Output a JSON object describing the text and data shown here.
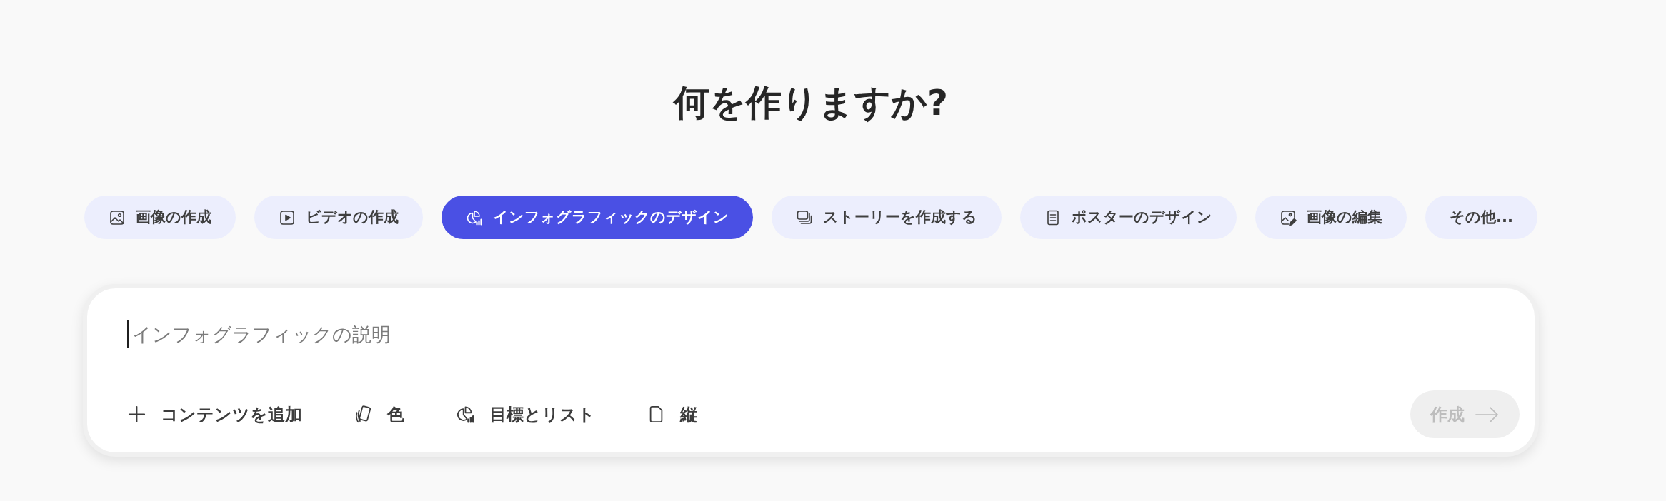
{
  "title": "何を作りますか?",
  "categories": [
    {
      "label": "画像の作成",
      "kind": "image",
      "selected": false
    },
    {
      "label": "ビデオの作成",
      "kind": "video",
      "selected": false
    },
    {
      "label": "インフォグラフィックのデザイン",
      "kind": "infographic",
      "selected": true
    },
    {
      "label": "ストーリーを作成する",
      "kind": "story",
      "selected": false
    },
    {
      "label": "ポスターのデザイン",
      "kind": "poster",
      "selected": false
    },
    {
      "label": "画像の編集",
      "kind": "edit",
      "selected": false
    },
    {
      "label": "その他...",
      "kind": "more",
      "selected": false
    }
  ],
  "prompt": {
    "placeholder": "インフォグラフィックの説明",
    "focused": true
  },
  "options": [
    {
      "label": "コンテンツを追加",
      "kind": "add"
    },
    {
      "label": "色",
      "kind": "color"
    },
    {
      "label": "目標とリスト",
      "kind": "goals"
    },
    {
      "label": "縦",
      "kind": "orientation"
    }
  ],
  "submit": {
    "label": "作成",
    "disabled": true
  }
}
